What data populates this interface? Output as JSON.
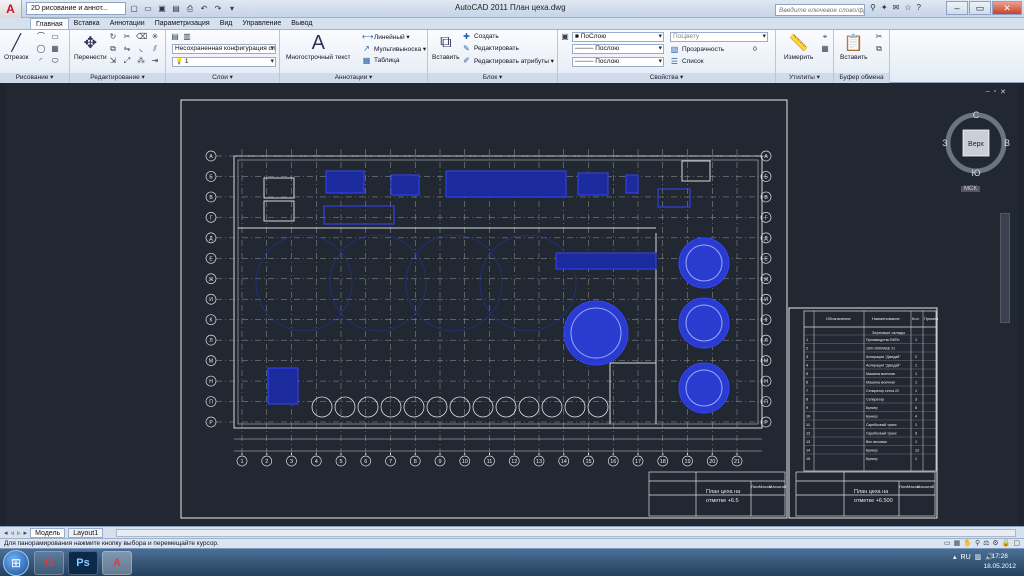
{
  "titlebar": {
    "workspace": "2D рисование и аннот...",
    "title": "AutoCAD 2011     План цеха.dwg",
    "search_placeholder": "Введите ключевое слово/фразу"
  },
  "tabs": [
    "Главная",
    "Вставка",
    "Аннотации",
    "Параметризация",
    "Вид",
    "Управление",
    "Вывод"
  ],
  "ribbon": {
    "draw": {
      "line_label": "Отрезок",
      "title": "Рисование ▾"
    },
    "modify": {
      "move_label": "Перенести",
      "title": "Редактирование ▾"
    },
    "layers": {
      "layer_state": "Несохраненная конфигурация сл",
      "current_layer": "1",
      "title": "Слои ▾"
    },
    "annotation": {
      "mtext_label": "Многострочный текст",
      "linear": "Линейный ▾",
      "multileader": "Мультивыноска ▾",
      "table": "Таблица",
      "title": "Аннотации ▾"
    },
    "block": {
      "insert_label": "Вставить",
      "create": "Создать",
      "edit": "Редактировать",
      "edit_attr": "Редактировать атрибуты ▾",
      "title": "Блок ▾"
    },
    "properties": {
      "color": "ПоСлою",
      "lineweight1": "Послою",
      "linetype": "Послою",
      "plotstyle": "ПоЦвету",
      "transparency_label": "Прозрачность",
      "transparency_value": "0",
      "list": "Список",
      "title": "Свойства ▾"
    },
    "utilities": {
      "measure_label": "Измерить",
      "title": "Утилиты ▾"
    },
    "clipboard": {
      "paste_label": "Вставить",
      "title": "Буфер обмена"
    }
  },
  "viewcube": {
    "north": "С",
    "south": "Ю",
    "west": "З",
    "east": "В",
    "face": "Верх",
    "wcs": "МСК"
  },
  "drawing": {
    "row_axes": [
      "А",
      "Б",
      "В",
      "Г",
      "Д",
      "Е",
      "Ж",
      "И",
      "К",
      "Л",
      "М",
      "Н",
      "П",
      "Р"
    ],
    "col_axes": [
      "1",
      "2",
      "3",
      "4",
      "5",
      "6",
      "7",
      "8",
      "9",
      "10",
      "11",
      "12",
      "13",
      "14",
      "15",
      "16",
      "17",
      "18",
      "19",
      "20",
      "21"
    ],
    "stamp1": {
      "line1": "План цеха на",
      "line2": "отметке +6.5",
      "col_a": "Лист",
      "col_b": "Масса",
      "col_c": "Масштаб"
    },
    "stamp2": {
      "line1": "План цеха на",
      "line2": "отметке +6.500",
      "col_a": "Лист",
      "col_b": "Масса",
      "col_c": "Масштаб"
    },
    "spec_header": [
      "Обозначение",
      "Наименование",
      "Кол",
      "Примеч"
    ],
    "spec_title": "Зерновые склады",
    "spec_rows": [
      [
        "1",
        "Производство ВКПн",
        "1"
      ],
      [
        "2",
        "100×1000/АБЕ 21",
        ""
      ],
      [
        "3",
        "Аспирация \"Джедай\"",
        "2"
      ],
      [
        "4",
        "Аспирация \"Джедай\"",
        "1"
      ],
      [
        "5",
        "Машина моечная",
        "1"
      ],
      [
        "6",
        "Машина моечная",
        "1"
      ],
      [
        "7",
        "Сепаратор сетка 22",
        "1"
      ],
      [
        "8",
        "Сепаратор",
        "3"
      ],
      [
        "9",
        "Бункер",
        "6"
      ],
      [
        "10",
        "Бункер",
        "4"
      ],
      [
        "11",
        "Скребковый транс",
        "1"
      ],
      [
        "12",
        "Скребковый транс",
        "3"
      ],
      [
        "13",
        "Вес весовая",
        "1"
      ],
      [
        "14",
        "Бункер",
        "12"
      ],
      [
        "15",
        "Бункер",
        "1"
      ]
    ]
  },
  "layout_tabs": [
    "Модель",
    "Layout1"
  ],
  "status": "Для панорамирования нажмите кнопку выбора и перемещайте курсор.",
  "taskbar": {
    "time": "17:28",
    "date": "18.05.2012",
    "lang": "RU"
  }
}
